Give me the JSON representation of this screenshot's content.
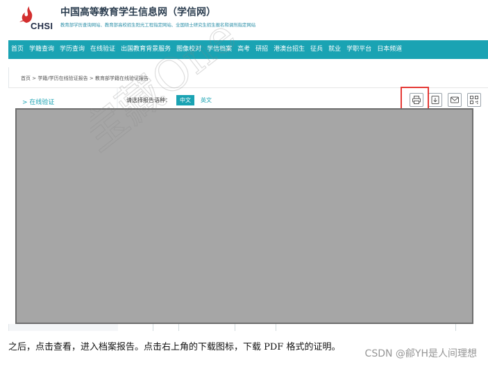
{
  "header": {
    "logo_text": "CHSI",
    "title": "中国高等教育学生信息网（学信网）",
    "subtitle": "教育部学历查询网站、教育部高校招生阳光工程指定网站、全国硕士研究生招生报名和调剂指定网站"
  },
  "nav": {
    "items": [
      "首页",
      "学籍查询",
      "学历查询",
      "在线验证",
      "出国教育背景服务",
      "图像校对",
      "学信档案",
      "高考",
      "研招",
      "港澳台招生",
      "征兵",
      "就业",
      "学职平台",
      "日本频道"
    ]
  },
  "breadcrumb": {
    "text": "首页 > 学籍/学历在线验证报告 > 教育部学籍在线验证报告"
  },
  "sidebar": {
    "items": [
      {
        "label": "> 在线验证"
      }
    ]
  },
  "report": {
    "lang_label": "请选择报告语种：",
    "lang_active": "中文",
    "lang_other": "英文"
  },
  "toolbar": {
    "icons": [
      "printer-icon",
      "download-icon",
      "mail-icon",
      "qrcode-icon"
    ]
  },
  "watermark": {
    "text": "宝藏One"
  },
  "caption": {
    "text": "之后，点击查看，进入档案报告。点击右上角的下载图标，下载 PDF 格式的证明。"
  },
  "credit": {
    "text": "CSDN @鄃YH是人间理想"
  },
  "colors": {
    "accent": "#1aa3b3",
    "highlight": "#e53935",
    "preview": "#a6a6a6"
  }
}
